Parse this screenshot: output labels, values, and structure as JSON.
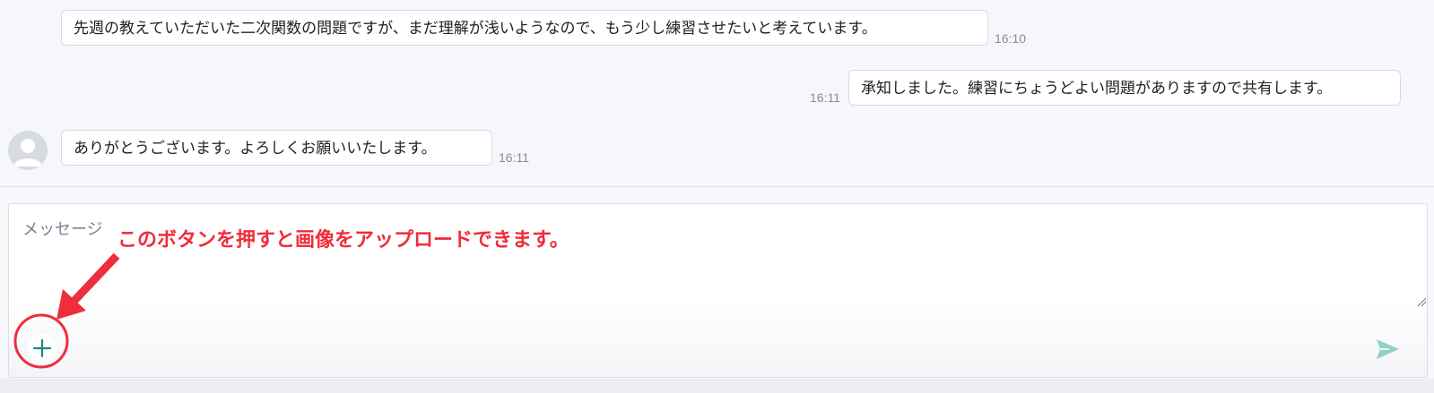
{
  "messages": [
    {
      "text": "先週の教えていただいた二次関数の問題ですが、まだ理解が浅いようなので、もう少し練習させたいと考えています。",
      "time": "16:10",
      "side": "left"
    },
    {
      "text": "承知しました。練習にちょうどよい問題がありますので共有します。",
      "time": "16:11",
      "side": "right"
    },
    {
      "text": "ありがとうございます。よろしくお願いいたします。",
      "time": "16:11",
      "side": "left"
    }
  ],
  "composer": {
    "placeholder": "メッセージ",
    "add_icon": "plus-icon",
    "send_icon": "send-icon"
  },
  "annotation": {
    "text": "このボタンを押すと画像をアップロードできます。",
    "color": "#ee2e3b"
  },
  "colors": {
    "accent": "#1a8c7d",
    "send": "#8fd3c6",
    "annotation": "#ee2e3b"
  }
}
